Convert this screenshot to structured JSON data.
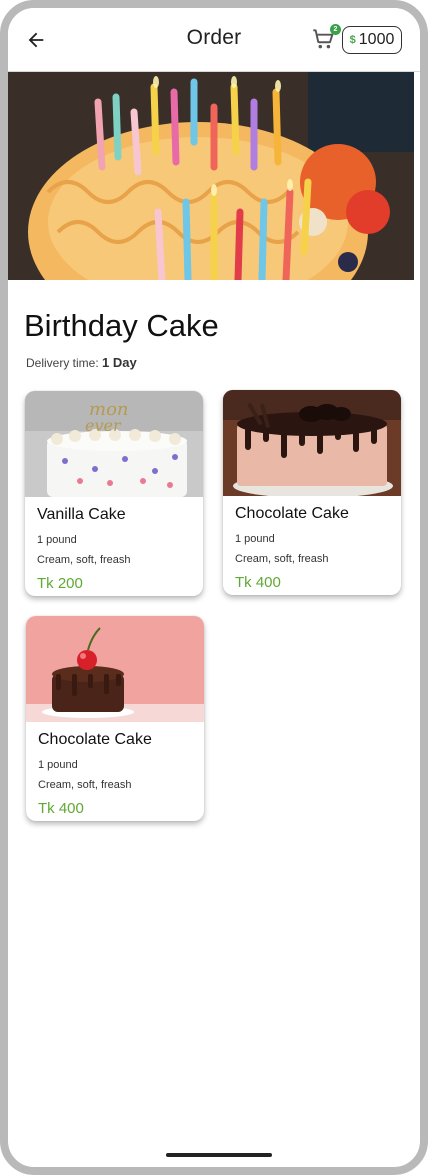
{
  "app_bar": {
    "title": "Order",
    "back_icon": "arrow-left-icon",
    "cart_icon": "cart-icon",
    "cart_count": "2",
    "coin_icon": "coin-icon",
    "coin_symbol": "$",
    "coin_balance": "1000"
  },
  "hero": {
    "image": "birthday-cake-candles-photo"
  },
  "product": {
    "title": "Birthday Cake",
    "delivery_label": "Delivery time:",
    "delivery_value": "1 Day"
  },
  "cards": [
    {
      "name": "Vanilla Cake",
      "weight": "1 pound",
      "description": "Cream, soft, freash",
      "price": "Tk 200",
      "image": "vanilla-cake-photo"
    },
    {
      "name": "Chocolate Cake",
      "weight": "1 pound",
      "description": "Cream, soft, freash",
      "price": "Tk 400",
      "image": "chocolate-drip-cake-photo"
    },
    {
      "name": "Chocolate Cake",
      "weight": "1 pound",
      "description": "Cream, soft, freash",
      "price": "Tk 400",
      "image": "cherry-chocolate-cake-photo"
    }
  ],
  "colors": {
    "price_green": "#5fa934",
    "badge_green": "#3aa14a",
    "text_dark": "#111111"
  }
}
